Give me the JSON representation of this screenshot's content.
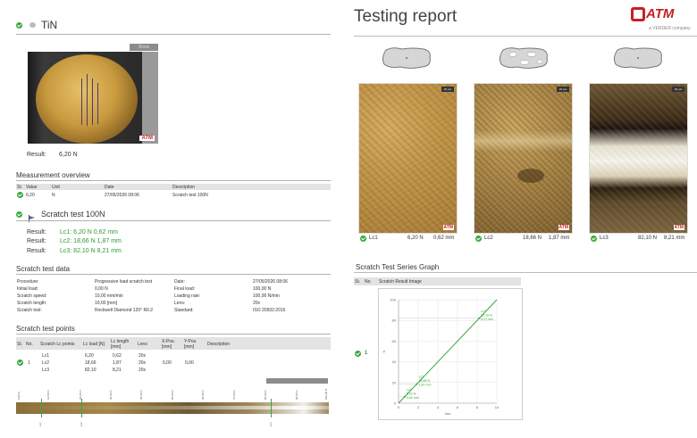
{
  "left": {
    "coating_title": "TiN",
    "photo_button_label": "Show",
    "result_label": "Result:",
    "result_value": "6,20 N",
    "overview_title": "Measurement overview",
    "overview_headers": [
      "St.",
      "Value",
      "Unit",
      "Date",
      "Description"
    ],
    "overview_row": {
      "value": "6,20",
      "unit": "N",
      "date": "27/05/2026 08:06",
      "description": "Scratch test 100N"
    },
    "scratch_title": "Scratch test 100N",
    "scratch_results": [
      {
        "label": "Result:",
        "value": "Lc1: 6,20 N 0,62 mm"
      },
      {
        "label": "Result:",
        "value": "Lc2: 18,66 N 1,87 mm"
      },
      {
        "label": "Result:",
        "value": "Lc3: 82,10 N 8,21 mm"
      }
    ],
    "data_title": "Scratch test data",
    "data_rows_left": [
      {
        "k": "Procedure:",
        "v": "Progressive load scratch test"
      },
      {
        "k": "Initial load:",
        "v": "0,00 N"
      },
      {
        "k": "Scratch speed:",
        "v": "10,00 mm/min"
      },
      {
        "k": "Scratch length:",
        "v": "10,00 [mm]"
      },
      {
        "k": "Scratch tool:",
        "v": "Rockwell Diamond 120° R0.2"
      }
    ],
    "data_rows_right": [
      {
        "k": "Date:",
        "v": "27/05/2026 08:06"
      },
      {
        "k": "Final load:",
        "v": "100,00 N"
      },
      {
        "k": "Loading rate:",
        "v": "100,00 N/min"
      },
      {
        "k": "Lens:",
        "v": "20x"
      },
      {
        "k": "Standard:",
        "v": "ISO 20502:2016"
      }
    ],
    "points_title": "Scratch test points",
    "points_headers": [
      "St.",
      "No.",
      "Scratch Lc points",
      "Lc load [N]",
      "Lc length [mm]",
      "Lens",
      "X-Pos. [mm]",
      "Y-Pos. [mm]",
      "Description"
    ],
    "points_no": "1",
    "points_rows": [
      {
        "lc": "Lc1",
        "load": "6,20",
        "len": "0,62",
        "lens": "20x",
        "x": "",
        "y": ""
      },
      {
        "lc": "Lc2",
        "load": "18,66",
        "len": "1,87",
        "lens": "20x",
        "x": "0,00",
        "y": "0,00"
      },
      {
        "lc": "Lc3",
        "load": "82,10",
        "len": "8,21",
        "lens": "20x",
        "x": "",
        "y": ""
      }
    ]
  },
  "right": {
    "report_title": "Testing report",
    "logo_text": "ATM",
    "logo_sub": "a VERDER company",
    "micro": [
      {
        "lc": "Lc1",
        "load": "6,20 N",
        "len": "0,62 mm"
      },
      {
        "lc": "Lc2",
        "load": "18,66 N",
        "len": "1,87 mm"
      },
      {
        "lc": "Lc3",
        "load": "82,10 N",
        "len": "8,21 mm"
      }
    ],
    "graph_title": "Scratch Test Series Graph",
    "graph_headers": [
      "St.",
      "No.",
      "Scratch Result Image"
    ],
    "graph_no": "1",
    "colors": {
      "accent": "#3aa63d",
      "brand": "#c62020"
    }
  },
  "chart_data": {
    "type": "line",
    "xlabel": "mm",
    "ylabel": "N",
    "xlim": [
      0,
      10
    ],
    "ylim": [
      0,
      100
    ],
    "x_ticks": [
      "0",
      "2",
      "4",
      "6",
      "8",
      "10"
    ],
    "y_ticks": [
      "0",
      "20",
      "40",
      "60",
      "80",
      "100"
    ],
    "series": [
      {
        "x": [
          0,
          10
        ],
        "values": [
          0,
          100
        ]
      }
    ],
    "annotations": [
      {
        "x": 0.62,
        "y": 6.2,
        "text": [
          "Lc1",
          "6,20 N",
          "0,62 mm"
        ]
      },
      {
        "x": 1.87,
        "y": 18.66,
        "text": [
          "Lc2",
          "18,66 N",
          "1,87 mm"
        ]
      },
      {
        "x": 8.21,
        "y": 82.1,
        "text": [
          "Lc3",
          "82,10 N",
          "8,21 mm"
        ]
      }
    ],
    "grid": true
  }
}
